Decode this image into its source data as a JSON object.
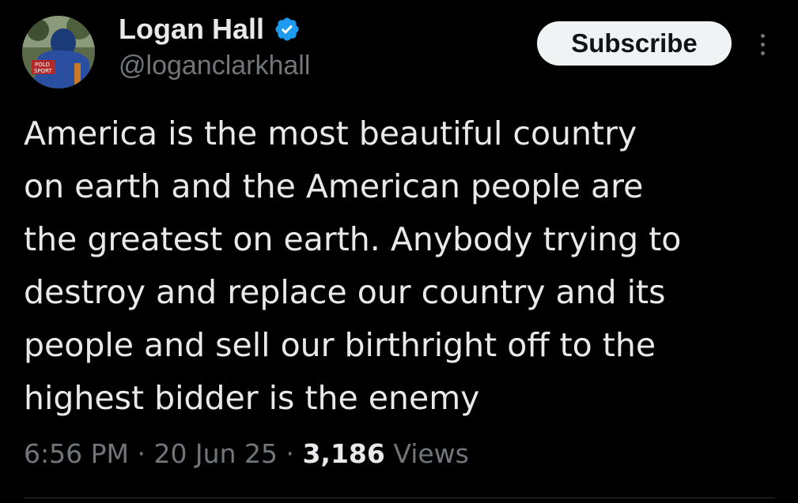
{
  "colors": {
    "background": "#000000",
    "text_primary": "#e7e9ea",
    "text_secondary": "#71767b",
    "verified_badge": "#1d9bf0",
    "subscribe_bg": "#eff3f4"
  },
  "author": {
    "display_name": "Logan Hall",
    "handle": "@loganclarkhall",
    "verified_icon": "verified-badge-icon",
    "avatar_text_1": "POLO",
    "avatar_text_2": "SPORT"
  },
  "actions": {
    "subscribe_label": "Subscribe",
    "more_icon": "more-vertical-icon"
  },
  "tweet": {
    "text_lines": [
      "America is the most beautiful country",
      "on earth and the American people are",
      "the greatest on earth. Anybody trying to",
      "destroy and replace our country and its",
      "people and sell our birthright off to the",
      "highest bidder is the enemy"
    ]
  },
  "meta": {
    "time": "6:56 PM",
    "separator_1": " · ",
    "date": "20 Jun 25",
    "separator_2": " · ",
    "views_count": "3,186",
    "views_label": " Views"
  }
}
